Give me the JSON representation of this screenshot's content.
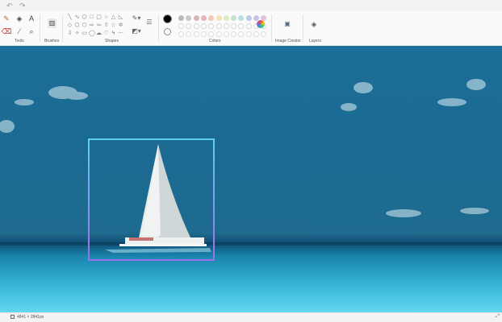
{
  "titlebar": {
    "undo_icon": "undo-arrow",
    "redo_icon": "redo-arrow"
  },
  "groups": {
    "tools": "Tools",
    "brushes": "Brushes",
    "shapes": "Shapes",
    "colors": "Colors",
    "image_creator": "Image Creator",
    "layers": "Layers"
  },
  "tools": [
    {
      "name": "pencil",
      "glyph": "✎"
    },
    {
      "name": "fill",
      "glyph": "◈"
    },
    {
      "name": "text",
      "glyph": "A"
    },
    {
      "name": "eraser",
      "glyph": "⌫"
    },
    {
      "name": "color-picker",
      "glyph": "⁄"
    },
    {
      "name": "magnifier",
      "glyph": "⌕"
    }
  ],
  "colors": {
    "primary": "#000000",
    "secondary": "#ffffff",
    "palette_row1": [
      "#b8b8b8",
      "#c9c9c9",
      "#d9b4b4",
      "#e8b4b8",
      "#f2c9b8",
      "#f4e3b0",
      "#dcecc0",
      "#c4e4d0",
      "#b8e0e8",
      "#b8cce8",
      "#ccc0e8",
      "#e4c0e0"
    ],
    "palette_row2": [
      "#ffffff",
      "#ffffff",
      "#ffffff",
      "#ffffff",
      "#ffffff",
      "#ffffff",
      "#ffffff",
      "#ffffff",
      "#ffffff",
      "#ffffff",
      "#ffffff",
      "#ffffff"
    ]
  },
  "status": {
    "dimensions": "4841 × 2841px"
  },
  "selection": {
    "active": true
  }
}
